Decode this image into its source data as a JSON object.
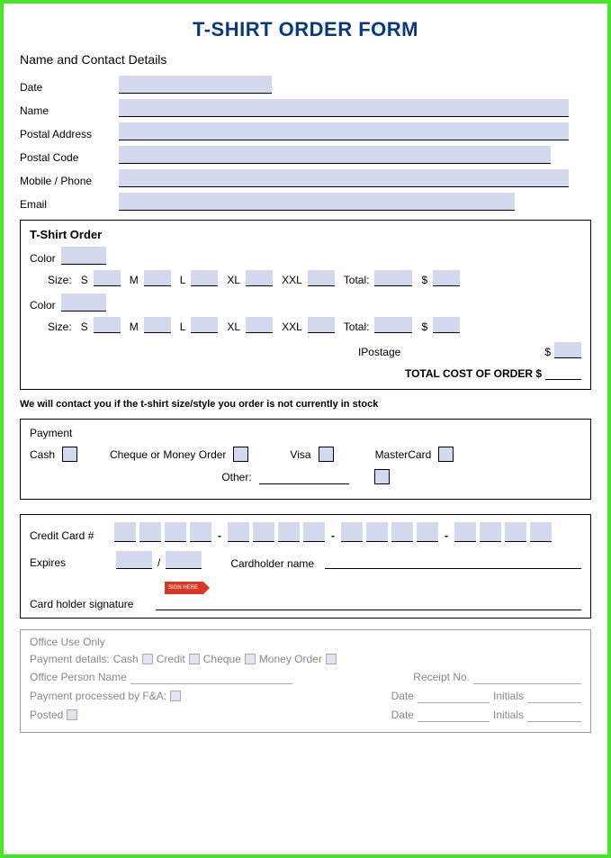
{
  "title": "T-SHIRT ORDER FORM",
  "contact": {
    "heading": "Name and Contact Details",
    "date": "Date",
    "name": "Name",
    "postal_address": "Postal   Address",
    "postal_code": "Postal Code",
    "mobile": "Mobile / Phone",
    "email": "Email"
  },
  "order": {
    "heading": "T-Shirt  Order",
    "color": "Color",
    "size": "Size:",
    "s": "S",
    "m": "M",
    "l": "L",
    "xl": "XL",
    "xxl": "XXL",
    "total": "Total:",
    "dollar": "$",
    "postage": "IPostage",
    "total_cost": "TOTAL COST OF ORDER  $"
  },
  "stock_note": "We will contact you if the t-shirt size/style you order is not currently in stock",
  "payment": {
    "heading": "Payment",
    "cash": "Cash",
    "cheque": "Cheque or Money Order",
    "visa": "Visa",
    "mastercard": "MasterCard",
    "other": "Other:"
  },
  "card": {
    "cc_num": "Credit Card #",
    "expires": "Expires",
    "slash": "/",
    "cardholder": "Cardholder name",
    "sign_here": "SIGN HERE",
    "signature": "Card holder signature"
  },
  "office": {
    "heading": "Office  Use Only",
    "details": "Payment details:",
    "cash": "Cash",
    "credit": "Credit",
    "cheque": "Cheque",
    "money_order": "Money Order",
    "person": "Office Person Name",
    "receipt": "Receipt No.",
    "processed": "Payment processed by F&A:",
    "date": "Date",
    "initials": "Initials",
    "posted": "Posted"
  }
}
